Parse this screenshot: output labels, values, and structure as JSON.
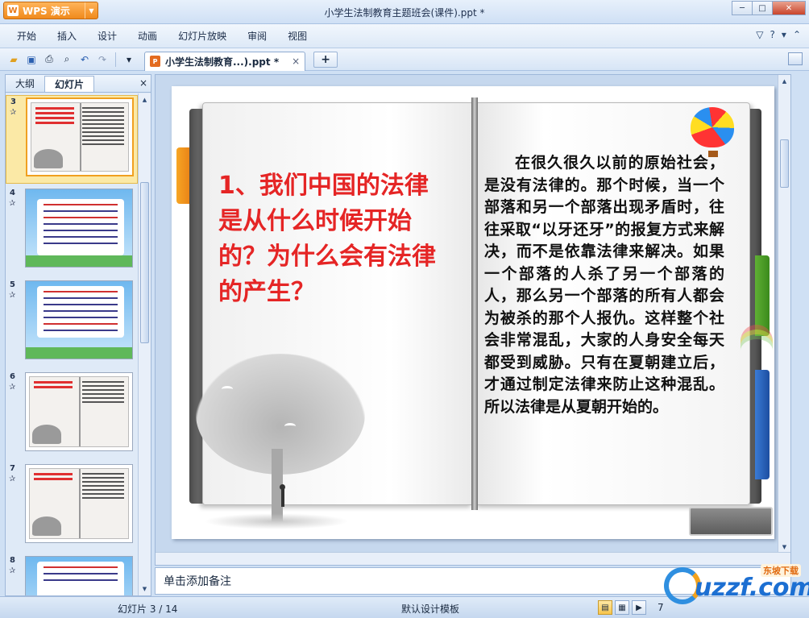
{
  "app": {
    "brand_label": "WPS 演示",
    "window_title": "小学生法制教育主题班会(课件).ppt *",
    "window_controls": [
      "minimize-icon",
      "maximize-icon",
      "close-icon"
    ]
  },
  "menu": {
    "items": [
      "开始",
      "插入",
      "设计",
      "动画",
      "幻灯片放映",
      "审阅",
      "视图"
    ],
    "right_icons": [
      "skin-icon",
      "help-icon",
      "chevron-down-icon",
      "settings-icon"
    ]
  },
  "toolbar": {
    "icons": [
      "open-icon",
      "save-icon",
      "print-icon",
      "print-preview-icon",
      "undo-icon",
      "redo-icon",
      "dropdown-icon"
    ],
    "doc_tab": "小学生法制教育...).ppt *",
    "tab_close": "×",
    "new_tab": "+"
  },
  "left_pane": {
    "tabs": [
      "大纲",
      "幻灯片"
    ],
    "active_tab": "幻灯片",
    "close": "×",
    "thumbnails": [
      {
        "num": "3",
        "selected": true
      },
      {
        "num": "4",
        "selected": false
      },
      {
        "num": "5",
        "selected": false
      },
      {
        "num": "6",
        "selected": false
      },
      {
        "num": "7",
        "selected": false
      },
      {
        "num": "8",
        "selected": false
      }
    ]
  },
  "slide": {
    "title": "1、我们中国的法律是从什么时候开始的？为什么会有法律的产生？",
    "body": "在很久很久以前的原始社会，是没有法律的。那个时候，当一个部落和另一个部落出现矛盾时，往往采取“以牙还牙”的报复方式来解决，而不是依靠法律来解决。如果一个部落的人杀了另一个部落的人，那么另一个部落的所有人都会为被杀的那个人报仇。这样整个社会非常混乱，大家的人身安全每天都受到威胁。只有在夏朝建立后，才通过制定法律来防止这种混乱。所以法律是从夏朝开始的。"
  },
  "notes": {
    "placeholder": "单击添加备注"
  },
  "status": {
    "slide_counter": "幻灯片 3 / 14",
    "template": "默认设计模板",
    "zoom": "7"
  },
  "watermark": {
    "text": "uzzf.com",
    "sub": "东坡下载"
  },
  "colors": {
    "accent": "#f08a1c",
    "title_red": "#e52525",
    "frame_blue": "#cfe0f4"
  }
}
